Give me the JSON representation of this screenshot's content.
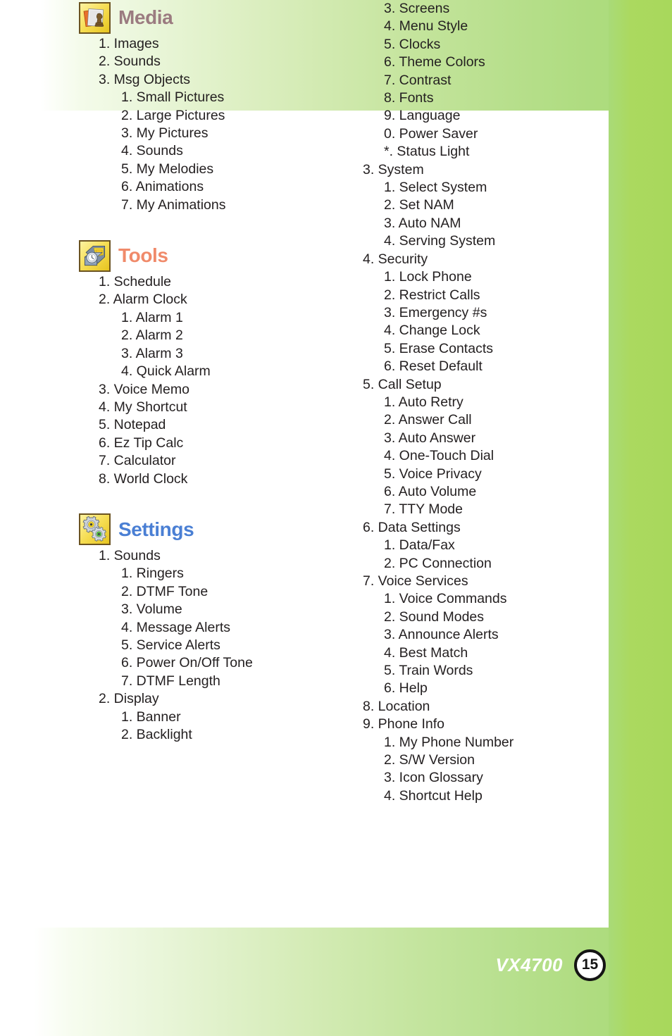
{
  "document": {
    "model": "VX4700",
    "page_number": "15"
  },
  "colors": {
    "media_title": "#9b7b80",
    "tools_title": "#f08a6a",
    "settings_title": "#4a7fd4",
    "band_green": "#abd95f",
    "text": "#231f20",
    "icon_tile_border": "#6b5320"
  },
  "sections": [
    {
      "id": "media",
      "title": "Media",
      "icon": "media-photos-icon",
      "column": "left",
      "items": [
        {
          "label": "1. Images",
          "level": 1
        },
        {
          "label": "2. Sounds",
          "level": 1
        },
        {
          "label": "3. Msg Objects",
          "level": 1
        },
        {
          "label": "1. Small Pictures",
          "level": 2
        },
        {
          "label": "2. Large Pictures",
          "level": 2
        },
        {
          "label": "3. My Pictures",
          "level": 2
        },
        {
          "label": "4. Sounds",
          "level": 2
        },
        {
          "label": "5. My Melodies",
          "level": 2
        },
        {
          "label": "6. Animations",
          "level": 2
        },
        {
          "label": "7. My Animations",
          "level": 2
        }
      ]
    },
    {
      "id": "tools",
      "title": "Tools",
      "icon": "toolbox-icon",
      "column": "left",
      "items": [
        {
          "label": "1. Schedule",
          "level": 1
        },
        {
          "label": "2. Alarm Clock",
          "level": 1
        },
        {
          "label": "1. Alarm 1",
          "level": 2
        },
        {
          "label": "2. Alarm 2",
          "level": 2
        },
        {
          "label": "3. Alarm 3",
          "level": 2
        },
        {
          "label": "4. Quick Alarm",
          "level": 2
        },
        {
          "label": "3. Voice Memo",
          "level": 1
        },
        {
          "label": "4. My Shortcut",
          "level": 1
        },
        {
          "label": "5. Notepad",
          "level": 1
        },
        {
          "label": "6. Ez Tip Calc",
          "level": 1
        },
        {
          "label": "7. Calculator",
          "level": 1
        },
        {
          "label": "8. World Clock",
          "level": 1
        }
      ]
    },
    {
      "id": "settings",
      "title": "Settings",
      "icon": "gears-icon",
      "column": "left",
      "items": [
        {
          "label": "1. Sounds",
          "level": 1
        },
        {
          "label": "1. Ringers",
          "level": 2
        },
        {
          "label": "2. DTMF Tone",
          "level": 2
        },
        {
          "label": "3. Volume",
          "level": 2
        },
        {
          "label": "4. Message Alerts",
          "level": 2
        },
        {
          "label": "5. Service Alerts",
          "level": 2
        },
        {
          "label": "6. Power On/Off Tone",
          "level": 2
        },
        {
          "label": "7. DTMF Length",
          "level": 2
        },
        {
          "label": "2. Display",
          "level": 1
        },
        {
          "label": "1. Banner",
          "level": 2
        },
        {
          "label": "2. Backlight",
          "level": 2
        }
      ]
    }
  ],
  "settings_continued": {
    "column": "right",
    "items": [
      {
        "label": "3. Screens",
        "level": 2
      },
      {
        "label": "4. Menu Style",
        "level": 2
      },
      {
        "label": "5. Clocks",
        "level": 2
      },
      {
        "label": "6. Theme Colors",
        "level": 2
      },
      {
        "label": "7. Contrast",
        "level": 2
      },
      {
        "label": "8. Fonts",
        "level": 2
      },
      {
        "label": "9. Language",
        "level": 2
      },
      {
        "label": "0. Power Saver",
        "level": 2
      },
      {
        "label": "*. Status Light",
        "level": 2
      },
      {
        "label": "3. System",
        "level": 1
      },
      {
        "label": "1. Select System",
        "level": 2
      },
      {
        "label": "2. Set NAM",
        "level": 2
      },
      {
        "label": "3. Auto NAM",
        "level": 2
      },
      {
        "label": "4. Serving System",
        "level": 2
      },
      {
        "label": "4. Security",
        "level": 1
      },
      {
        "label": "1. Lock Phone",
        "level": 2
      },
      {
        "label": "2. Restrict Calls",
        "level": 2
      },
      {
        "label": "3. Emergency #s",
        "level": 2
      },
      {
        "label": "4. Change Lock",
        "level": 2
      },
      {
        "label": "5. Erase Contacts",
        "level": 2
      },
      {
        "label": "6. Reset Default",
        "level": 2
      },
      {
        "label": "5. Call Setup",
        "level": 1
      },
      {
        "label": "1. Auto Retry",
        "level": 2
      },
      {
        "label": "2. Answer Call",
        "level": 2
      },
      {
        "label": "3. Auto Answer",
        "level": 2
      },
      {
        "label": "4. One-Touch Dial",
        "level": 2
      },
      {
        "label": "5. Voice Privacy",
        "level": 2
      },
      {
        "label": "6. Auto Volume",
        "level": 2
      },
      {
        "label": "7. TTY Mode",
        "level": 2
      },
      {
        "label": "6. Data Settings",
        "level": 1
      },
      {
        "label": "1. Data/Fax",
        "level": 2
      },
      {
        "label": "2. PC Connection",
        "level": 2
      },
      {
        "label": "7. Voice Services",
        "level": 1
      },
      {
        "label": "1. Voice Commands",
        "level": 2
      },
      {
        "label": "2. Sound Modes",
        "level": 2
      },
      {
        "label": "3. Announce Alerts",
        "level": 2
      },
      {
        "label": "4. Best Match",
        "level": 2
      },
      {
        "label": "5. Train Words",
        "level": 2
      },
      {
        "label": "6. Help",
        "level": 2
      },
      {
        "label": "8. Location",
        "level": 1
      },
      {
        "label": "9. Phone Info",
        "level": 1
      },
      {
        "label": "1. My Phone Number",
        "level": 2
      },
      {
        "label": "2. S/W Version",
        "level": 2
      },
      {
        "label": "3. Icon Glossary",
        "level": 2
      },
      {
        "label": "4. Shortcut Help",
        "level": 2
      }
    ]
  }
}
